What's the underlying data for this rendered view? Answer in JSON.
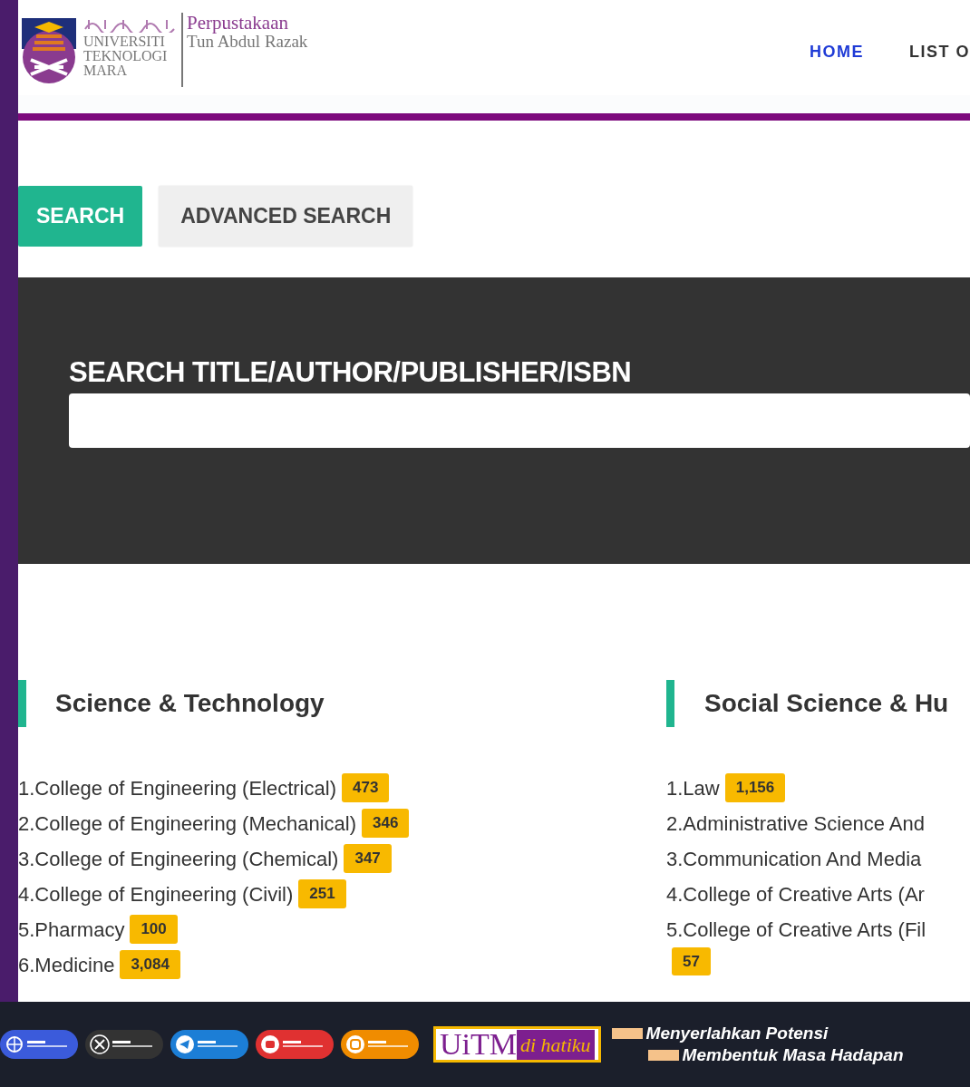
{
  "header": {
    "logo_lines": [
      "UNIVERSITI",
      "TEKNOLOGI",
      "MARA"
    ],
    "library_title": "Perpustakaan",
    "library_subtitle": "Tun Abdul Razak"
  },
  "nav": [
    {
      "label": "HOME",
      "selected": true
    },
    {
      "label": "LIST O",
      "selected": false
    }
  ],
  "search_tabs": [
    {
      "label": "SEARCH",
      "selected": true
    },
    {
      "label": "ADVANCED SEARCH",
      "selected": false
    }
  ],
  "search": {
    "label": "SEARCH TITLE/AUTHOR/PUBLISHER/ISBN"
  },
  "categories": [
    {
      "title": "Science & Technology",
      "items": [
        {
          "label": "1.College of Engineering (Electrical)",
          "count": "473"
        },
        {
          "label": "2.College of Engineering (Mechanical)",
          "count": "346"
        },
        {
          "label": "3.College of Engineering (Chemical)",
          "count": "347"
        },
        {
          "label": "4.College of Engineering (Civil)",
          "count": "251"
        },
        {
          "label": "5.Pharmacy",
          "count": "100"
        },
        {
          "label": "6.Medicine",
          "count": "3,084"
        }
      ]
    },
    {
      "title": "Social Science & Hu",
      "items": [
        {
          "label": "1.Law",
          "count": "1,156"
        },
        {
          "label": "2.Administrative Science And"
        },
        {
          "label": "3.Communication And Media"
        },
        {
          "label": "4.College of Creative Arts (Ar"
        },
        {
          "label": "5.College of Creative Arts (Fil",
          "count": "57"
        }
      ]
    }
  ],
  "footer": {
    "social_links": [
      {
        "kind": "globe",
        "color": "#3b5bdb"
      },
      {
        "kind": "x",
        "color": "#333333"
      },
      {
        "kind": "telegram",
        "color": "#1c7ed6"
      },
      {
        "kind": "youtube",
        "color": "#e03131"
      },
      {
        "kind": "instagram",
        "color": "#f08c00"
      }
    ],
    "brand_main": "UiTM",
    "brand_tag": "di hatiku",
    "slogan": [
      "Menyerlahkan Potensi",
      "Membentuk Masa Hadapan"
    ]
  }
}
